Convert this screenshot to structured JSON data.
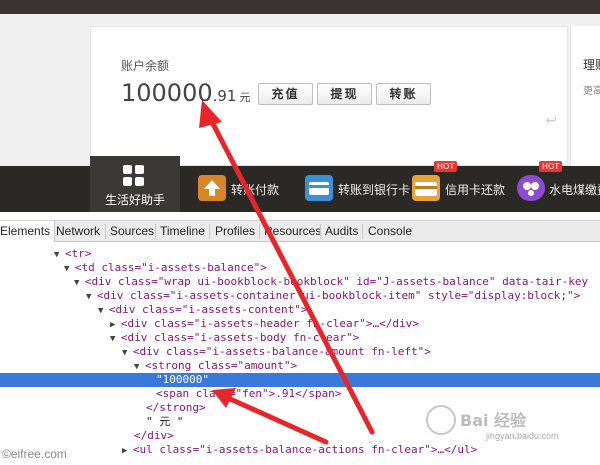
{
  "account": {
    "balance_label": "账户余额",
    "amount_int": "100000",
    "amount_fen": ".91",
    "currency": "元",
    "buttons": [
      "充值",
      "提现",
      "转账"
    ],
    "side_title": "理财",
    "side_sub": "更高"
  },
  "service_bar": {
    "active_label": "生活好助手",
    "items": [
      {
        "label": "转账付款",
        "hot": false,
        "icon": "transfer-icon",
        "color": "#d9862a"
      },
      {
        "label": "转账到银行卡",
        "hot": false,
        "icon": "bank-card-icon",
        "color": "#3d8fd6"
      },
      {
        "label": "信用卡还款",
        "hot": true,
        "icon": "credit-card-icon",
        "color": "#e7a23c"
      },
      {
        "label": "水电煤缴费",
        "hot": true,
        "icon": "utility-icon",
        "color": "#8e4bd0"
      }
    ],
    "hot_badge": "HOT"
  },
  "devtools": {
    "tabs": [
      "Elements",
      "Network",
      "Sources",
      "Timeline",
      "Profiles",
      "Resources",
      "Audits",
      "Console"
    ],
    "active_tab": "Elements",
    "lines": [
      "<tr>",
      "<td class=\"i-assets-balance\">",
      "<div class=\"wrap ui-bookblock-bookblock\" id=\"J-assets-balance\" data-tair-key",
      "<div class=\"i-assets-container ui-bookblock-item\" style=\"display:block;\">",
      "<div class=\"i-assets-content\">",
      "<div class=\"i-assets-header fn-clear\">…</div>",
      "<div class=\"i-assets-body fn-clear\">",
      "<div class=\"i-assets-balance-amount fn-left\">",
      "<strong class=\"amount\">",
      "\"100000\"",
      "<span class=\"fen\">.91</span>",
      "</strong>",
      "\" 元 \"",
      "</div>",
      "<ul class=\"i-assets-balance-actions fn-clear\">…</ul>"
    ]
  },
  "watermarks": {
    "left": "©eifree.com",
    "right_main": "Bai 经验",
    "right_url": "jingyan.baidu.com"
  },
  "colors": {
    "arrow": "#e8262a",
    "selection": "#3879d9",
    "dark_bar": "#2b2926"
  }
}
